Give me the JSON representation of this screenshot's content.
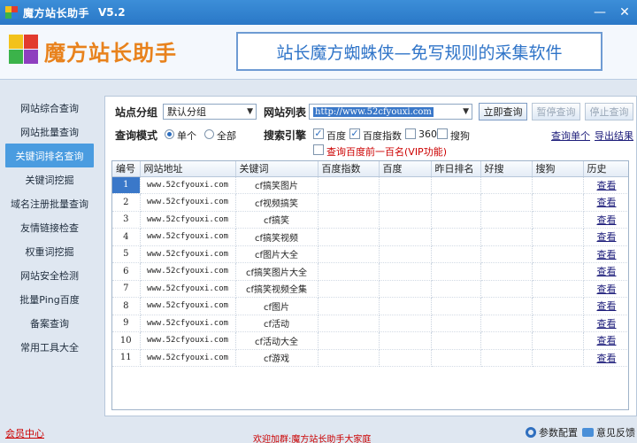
{
  "window": {
    "title": "魔方站长助手",
    "version": "V5.2",
    "minimize_glyph": "—",
    "close_glyph": "✕"
  },
  "banner": {
    "logo_text": "魔方站长助手",
    "slogan": "站长魔方蜘蛛侠—免写规则的采集软件"
  },
  "sidebar": {
    "items": [
      {
        "label": "网站综合查询",
        "active": false
      },
      {
        "label": "网站批量查询",
        "active": false
      },
      {
        "label": "关键词排名查询",
        "active": true
      },
      {
        "label": "关键词挖掘",
        "active": false
      },
      {
        "label": "域名注册批量查询",
        "active": false
      },
      {
        "label": "友情链接检查",
        "active": false
      },
      {
        "label": "权重词挖掘",
        "active": false
      },
      {
        "label": "网站安全检测",
        "active": false
      },
      {
        "label": "批量Ping百度",
        "active": false
      },
      {
        "label": "备案查询",
        "active": false
      },
      {
        "label": "常用工具大全",
        "active": false
      }
    ]
  },
  "form": {
    "group_label": "站点分组",
    "group_value": "默认分组",
    "site_list_label": "网站列表",
    "site_list_value": "http://www.52cfyouxi.com",
    "mode_label": "查询模式",
    "mode_single": "单个",
    "mode_all": "全部",
    "mode_selected": "single",
    "engine_label": "搜索引擎",
    "engines": [
      {
        "label": "百度",
        "checked": true
      },
      {
        "label": "百度指数",
        "checked": true
      },
      {
        "label": "360",
        "checked": false
      },
      {
        "label": "搜狗",
        "checked": false
      }
    ],
    "vip_option": {
      "label": "查询百度前一百名(VIP功能)",
      "checked": false
    },
    "query_now": "立即查询",
    "pause_query": "暂停查询",
    "stop_query": "停止查询",
    "query_single_link": "查询单个",
    "export_link": "导出结果"
  },
  "table": {
    "columns": [
      "编号",
      "网站地址",
      "关键词",
      "百度指数",
      "百度",
      "昨日排名",
      "好搜",
      "搜狗",
      "历史"
    ],
    "rows": [
      {
        "no": "1",
        "url": "www.52cfyouxi.com",
        "keyword": "cf搞笑图片",
        "history": "查看"
      },
      {
        "no": "2",
        "url": "www.52cfyouxi.com",
        "keyword": "cf视频搞笑",
        "history": "查看"
      },
      {
        "no": "3",
        "url": "www.52cfyouxi.com",
        "keyword": "cf搞笑",
        "history": "查看"
      },
      {
        "no": "4",
        "url": "www.52cfyouxi.com",
        "keyword": "cf搞笑视频",
        "history": "查看"
      },
      {
        "no": "5",
        "url": "www.52cfyouxi.com",
        "keyword": "cf图片大全",
        "history": "查看"
      },
      {
        "no": "6",
        "url": "www.52cfyouxi.com",
        "keyword": "cf搞笑图片大全",
        "history": "查看"
      },
      {
        "no": "7",
        "url": "www.52cfyouxi.com",
        "keyword": "cf搞笑视频全集",
        "history": "查看"
      },
      {
        "no": "8",
        "url": "www.52cfyouxi.com",
        "keyword": "cf图片",
        "history": "查看"
      },
      {
        "no": "9",
        "url": "www.52cfyouxi.com",
        "keyword": "cf活动",
        "history": "查看"
      },
      {
        "no": "10",
        "url": "www.52cfyouxi.com",
        "keyword": "cf活动大全",
        "history": "查看"
      },
      {
        "no": "11",
        "url": "www.52cfyouxi.com",
        "keyword": "cf游戏",
        "history": "查看"
      }
    ]
  },
  "status": {
    "member_center": "会员中心",
    "welcome": "欢迎加群:魔方站长助手大家庭",
    "settings": "参数配置",
    "feedback": "意见反馈"
  },
  "colors": {
    "titlebar": "#2a78c7",
    "accent": "#4a9ce0",
    "logo_orange": "#e8821c",
    "slogan_blue": "#2f74c8"
  }
}
